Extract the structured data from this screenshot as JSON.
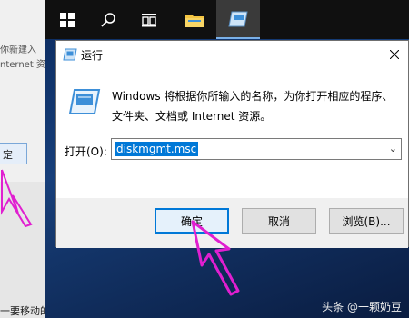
{
  "background_window": {
    "line1": "你新建入",
    "line2": "nternet 资",
    "button_label": "定",
    "bottom_text": "一要移动的"
  },
  "taskbar": {
    "items": [
      "windows-start",
      "search",
      "task-view",
      "file-explorer",
      "run-app"
    ]
  },
  "dialog": {
    "title": "运行",
    "description_line1": "Windows 将根据你所输入的名称，为你打开相应的程序、",
    "description_line2": "文件夹、文档或 Internet 资源。",
    "open_label": "打开(O):",
    "open_value": "diskmgmt.msc",
    "buttons": {
      "ok": "确定",
      "cancel": "取消",
      "browse": "浏览(B)..."
    }
  },
  "watermark": "头条 @一颗奶豆",
  "colors": {
    "accent": "#0078d7",
    "cursor": "#e01fd0"
  }
}
